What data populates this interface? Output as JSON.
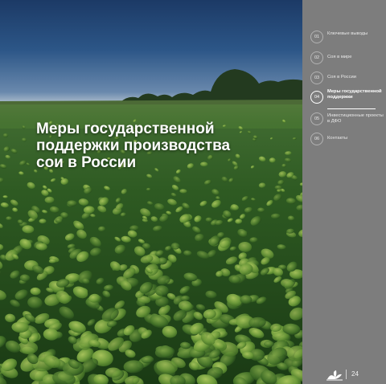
{
  "slide": {
    "title_lines": [
      "Меры государственной",
      "поддержки производства",
      "сои в России"
    ]
  },
  "nav": {
    "items": [
      {
        "number": "01",
        "label": "Ключевые выводы",
        "active": false
      },
      {
        "number": "02",
        "label": "Соя в мире",
        "active": false
      },
      {
        "number": "03",
        "label": "Соя в России",
        "active": false
      },
      {
        "number": "04",
        "label": "Меры государственной поддержки",
        "active": true
      },
      {
        "number": "05",
        "label": "Инвестиционные проекты в ДФО",
        "active": false
      },
      {
        "number": "06",
        "label": "Контакты",
        "active": false
      }
    ]
  },
  "footer": {
    "page_number": "24",
    "logo_icon": "plant-logo-icon"
  },
  "colors": {
    "sidebar_bg": "#7d7d7d",
    "sky_top": "#1c3a66",
    "field_green": "#2e5a22",
    "title_text": "#ffffff"
  }
}
